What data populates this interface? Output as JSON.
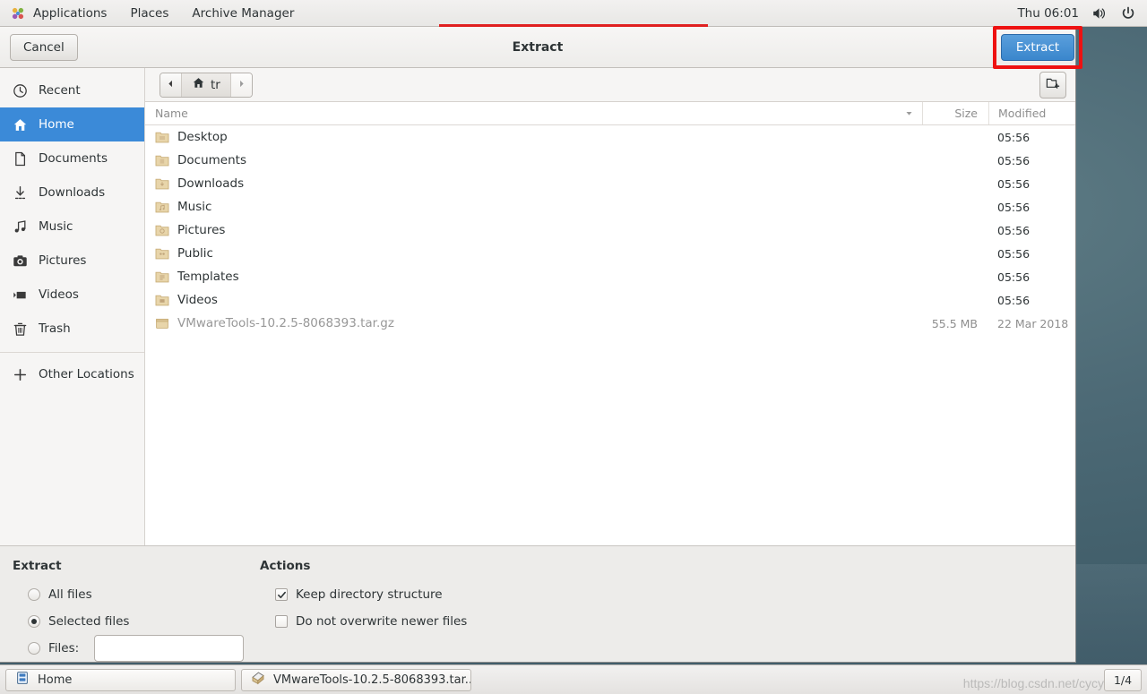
{
  "topbar": {
    "activities_icon": "applications-icon",
    "menus": [
      "Applications",
      "Places",
      "Archive Manager"
    ],
    "clock": "Thu 06:01",
    "volume_icon": "volume-icon",
    "power_icon": "power-icon",
    "accent_color": "#e02020"
  },
  "dialog": {
    "title": "Extract",
    "cancel_label": "Cancel",
    "extract_label": "Extract",
    "search_icon": "search-icon",
    "new_folder_icon": "new-folder-icon",
    "highlight_color": "#ee1111",
    "accent_color": "#3b8ad8"
  },
  "sidebar": {
    "items": [
      {
        "label": "Recent",
        "icon": "clock-icon",
        "active": false
      },
      {
        "label": "Home",
        "icon": "home-icon",
        "active": true
      },
      {
        "label": "Documents",
        "icon": "document-icon",
        "active": false
      },
      {
        "label": "Downloads",
        "icon": "download-icon",
        "active": false
      },
      {
        "label": "Music",
        "icon": "music-icon",
        "active": false
      },
      {
        "label": "Pictures",
        "icon": "camera-icon",
        "active": false
      },
      {
        "label": "Videos",
        "icon": "video-icon",
        "active": false
      },
      {
        "label": "Trash",
        "icon": "trash-icon",
        "active": false
      }
    ],
    "other_locations": {
      "label": "Other Locations",
      "icon": "plus-icon"
    }
  },
  "pathbar": {
    "back_icon": "chevron-left-icon",
    "forward_icon": "chevron-right-icon",
    "crumb_icon": "home-icon",
    "crumb_label": "tr"
  },
  "filelist": {
    "columns": {
      "name": "Name",
      "size": "Size",
      "modified": "Modified"
    },
    "sort_icon": "sort-descending-icon",
    "rows": [
      {
        "name": "Desktop",
        "icon": "folder-desktop-icon",
        "size": "",
        "modified": "05:56",
        "dim": false
      },
      {
        "name": "Documents",
        "icon": "folder-documents-icon",
        "size": "",
        "modified": "05:56",
        "dim": false
      },
      {
        "name": "Downloads",
        "icon": "folder-downloads-icon",
        "size": "",
        "modified": "05:56",
        "dim": false
      },
      {
        "name": "Music",
        "icon": "folder-music-icon",
        "size": "",
        "modified": "05:56",
        "dim": false
      },
      {
        "name": "Pictures",
        "icon": "folder-pictures-icon",
        "size": "",
        "modified": "05:56",
        "dim": false
      },
      {
        "name": "Public",
        "icon": "folder-public-icon",
        "size": "",
        "modified": "05:56",
        "dim": false
      },
      {
        "name": "Templates",
        "icon": "folder-templates-icon",
        "size": "",
        "modified": "05:56",
        "dim": false
      },
      {
        "name": "Videos",
        "icon": "folder-videos-icon",
        "size": "",
        "modified": "05:56",
        "dim": false
      },
      {
        "name": "VMwareTools-10.2.5-8068393.tar.gz",
        "icon": "archive-icon",
        "size": "55.5 MB",
        "modified": "22 Mar 2018",
        "dim": true
      }
    ]
  },
  "options": {
    "extract": {
      "title": "Extract",
      "choices": [
        {
          "label": "All files",
          "selected": false
        },
        {
          "label": "Selected files",
          "selected": true
        },
        {
          "label": "Files:",
          "selected": false
        }
      ],
      "files_value": "",
      "files_placeholder": ""
    },
    "actions": {
      "title": "Actions",
      "checks": [
        {
          "label": "Keep directory structure",
          "checked": true
        },
        {
          "label": "Do not overwrite newer files",
          "checked": false
        }
      ]
    }
  },
  "taskbar": {
    "buttons": [
      {
        "label": "Home",
        "icon": "file-manager-icon"
      },
      {
        "label": "VMwareTools-10.2.5-8068393.tar....",
        "icon": "archive-manager-icon"
      }
    ],
    "workspace": "1/4",
    "watermark": "https://blog.csdn.net/cycy"
  }
}
